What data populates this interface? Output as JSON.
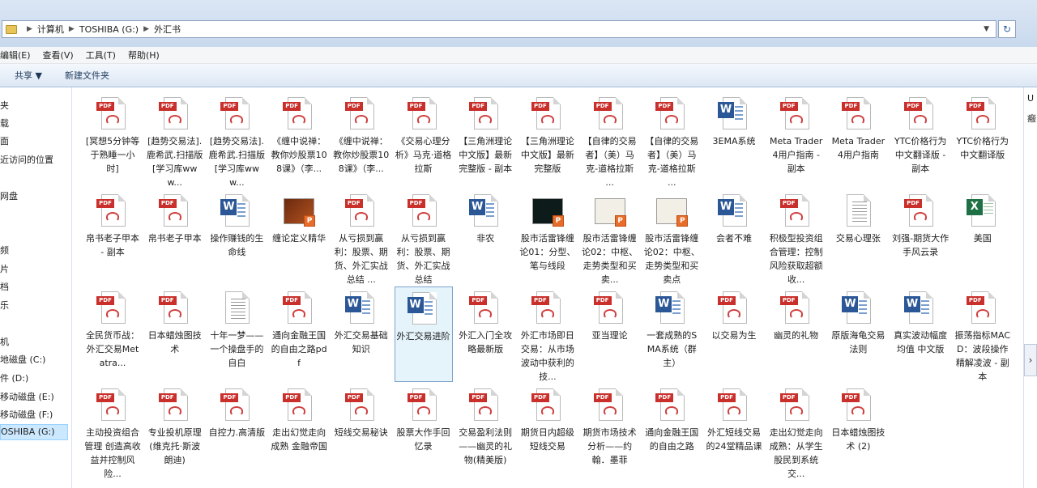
{
  "address_bar": {
    "crumbs": [
      "计算机",
      "TOSHIBA (G:)",
      "外汇书"
    ]
  },
  "menu": [
    "编辑(E)",
    "查看(V)",
    "工具(T)",
    "帮助(H)"
  ],
  "commands": [
    "共享 ▼",
    "新建文件夹"
  ],
  "nav": {
    "items": [
      "夹",
      "载",
      "面",
      "近访问的位置",
      "网盘",
      "频",
      "片",
      "档",
      "乐",
      "机",
      "地磁盘 (C:)",
      "件 (D:)",
      "移动磁盘 (E:)",
      "移动磁盘 (F:)",
      "OSHIBA (G:)"
    ],
    "selected_label": "OSHIBA (G:)"
  },
  "right_pane": [
    "U",
    "瘢"
  ],
  "files": [
    {
      "type": "pdf",
      "label": "[冥想5分钟等于熟睡一小时]"
    },
    {
      "type": "pdf",
      "label": "[趋势交易法].鹿希武.扫描版[学习库www..."
    },
    {
      "type": "pdf",
      "label": "[趋势交易法].鹿希武.扫描版[学习库www..."
    },
    {
      "type": "pdf",
      "label": "《缠中说禅：教你炒股票108课》（李..."
    },
    {
      "type": "pdf",
      "label": "《缠中说禅：教你炒股票108课》（李..."
    },
    {
      "type": "pdf",
      "label": "《交易心理分析》马克·道格拉斯"
    },
    {
      "type": "pdf",
      "label": "【三角洲理论中文版】最新完整版 - 副本"
    },
    {
      "type": "pdf",
      "label": "【三角洲理论中文版】最新完整版"
    },
    {
      "type": "pdf",
      "label": "【自律的交易者】（美）马克-道格拉斯 ..."
    },
    {
      "type": "pdf",
      "label": "【自律的交易者】（美）马克-道格拉斯 ..."
    },
    {
      "type": "word",
      "label": "3EMA系统"
    },
    {
      "type": "pdf",
      "label": "Meta Trader4用户指南 - 副本"
    },
    {
      "type": "pdf",
      "label": "Meta Trader4用户指南"
    },
    {
      "type": "pdf",
      "label": "YTC价格行为中文翻译版 - 副本"
    },
    {
      "type": "pdf",
      "label": "YTC价格行为中文翻译版"
    },
    {
      "type": "pdf",
      "label": "帛书老子甲本 - 副本"
    },
    {
      "type": "pdf",
      "label": "帛书老子甲本"
    },
    {
      "type": "word",
      "label": "操作赚钱的生命线"
    },
    {
      "type": "ppt-dark",
      "label": "缠论定义精华"
    },
    {
      "type": "pdf",
      "label": "从亏损到赢利：股票、期货、外汇实战总结 ..."
    },
    {
      "type": "pdf",
      "label": "从亏损到赢利：股票、期货、外汇实战总结"
    },
    {
      "type": "word",
      "label": "非农"
    },
    {
      "type": "ppt-chart",
      "label": "股市活雷锋缠论01：分型、笔与线段"
    },
    {
      "type": "ppt-chart2",
      "label": "股市活雷锋缠论02：中枢、走势类型和买卖..."
    },
    {
      "type": "ppt-chart2",
      "label": "股市活雷锋缠论02：中枢、走势类型和买卖点"
    },
    {
      "type": "word",
      "label": "会者不难"
    },
    {
      "type": "pdf",
      "label": "积极型投资组合管理：控制风险获取超额收..."
    },
    {
      "type": "txt",
      "label": "交易心理张"
    },
    {
      "type": "pdf",
      "label": "刘强-期货大作手风云录"
    },
    {
      "type": "excel",
      "label": "美国"
    },
    {
      "type": "pdf",
      "label": "全民货币战：外汇交易Metatra..."
    },
    {
      "type": "pdf",
      "label": "日本蜡烛图技术"
    },
    {
      "type": "txt",
      "label": "十年一梦——一个操盘手的自白"
    },
    {
      "type": "pdf",
      "label": "通向金融王国的自由之路pdf"
    },
    {
      "type": "word",
      "label": "外汇交易基础知识"
    },
    {
      "type": "word",
      "label": "外汇交易进阶",
      "selected": true
    },
    {
      "type": "pdf",
      "label": "外汇入门全攻略最新版"
    },
    {
      "type": "pdf",
      "label": "外汇市场即日交易：从市场波动中获利的技..."
    },
    {
      "type": "pdf",
      "label": "亚当理论"
    },
    {
      "type": "word",
      "label": "一套成熟的SMA系统（群主）"
    },
    {
      "type": "pdf",
      "label": "以交易为生"
    },
    {
      "type": "pdf",
      "label": "幽灵的礼物"
    },
    {
      "type": "word",
      "label": "原版海龟交易法则"
    },
    {
      "type": "word",
      "label": "真实波动幅度均值 中文版"
    },
    {
      "type": "pdf",
      "label": "振荡指标MACD：波段操作精解凌波 - 副本"
    },
    {
      "type": "pdf",
      "label": "主动投资组合管理 创造高收益并控制风险..."
    },
    {
      "type": "pdf",
      "label": "专业投机原理 (维克托·斯波朗迪)"
    },
    {
      "type": "pdf",
      "label": "自控力.高清版"
    },
    {
      "type": "pdf",
      "label": "走出幻觉走向成熟 金融帝国"
    },
    {
      "type": "pdf",
      "label": "短线交易秘诀"
    },
    {
      "type": "pdf",
      "label": "股票大作手回忆录"
    },
    {
      "type": "pdf",
      "label": "交易盈利法则——幽灵的礼物(精美版)"
    },
    {
      "type": "pdf",
      "label": "期货日内超级短线交易"
    },
    {
      "type": "pdf",
      "label": "期货市场技术分析——约翰．墨菲"
    },
    {
      "type": "pdf",
      "label": "通向金融王国的自由之路"
    },
    {
      "type": "pdf",
      "label": "外汇短线交易的24堂精品课"
    },
    {
      "type": "pdf",
      "label": "走出幻觉走向成熟：从学生股民到系统交..."
    },
    {
      "type": "pdf",
      "label": "日本蜡烛图技术 (2)"
    }
  ]
}
